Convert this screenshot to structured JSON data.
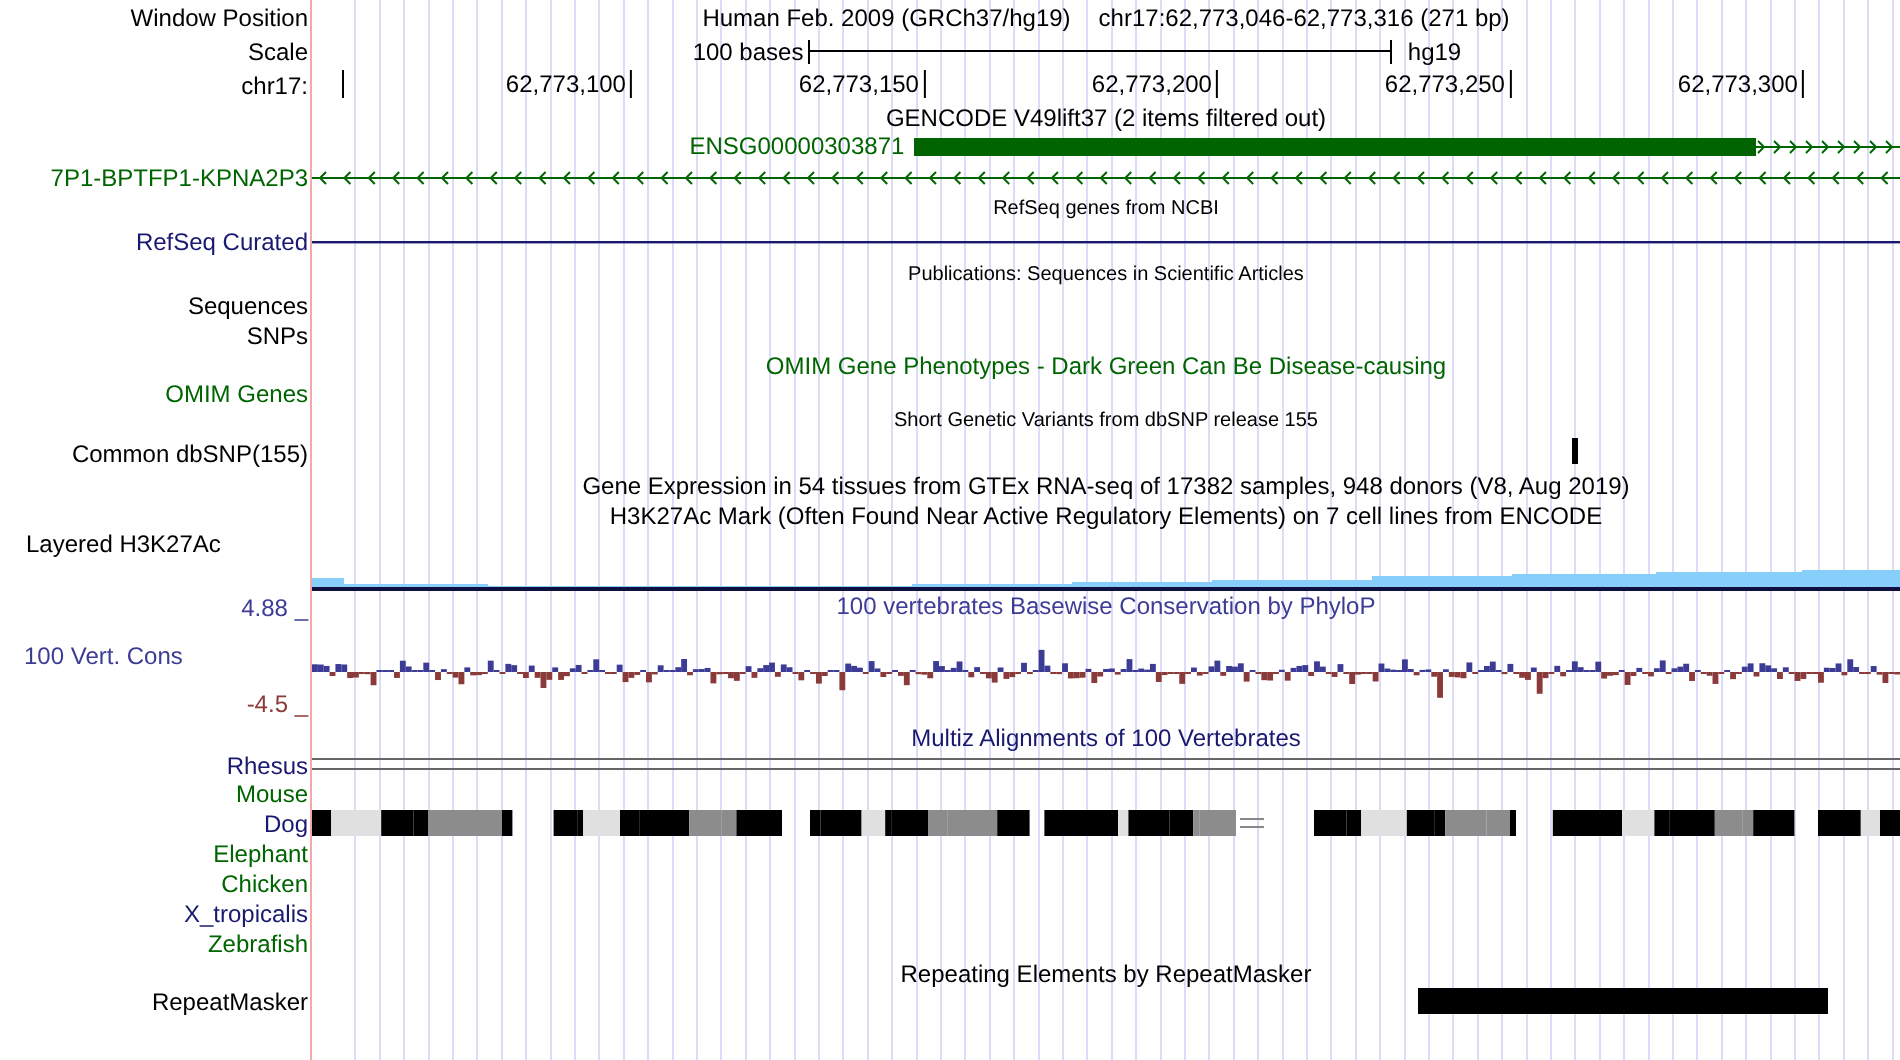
{
  "header": {
    "position_label": "Window Position",
    "assembly": "Human Feb. 2009 (GRCh37/hg19)",
    "position": "chr17:62,773,046-62,773,316 (271 bp)",
    "scale_label": "Scale",
    "scale_text": "100 bases",
    "scale_db": "hg19",
    "chrom_label": "chr17:",
    "ticks": [
      "62,773,100",
      "62,773,150",
      "62,773,200",
      "62,773,250",
      "62,773,300"
    ]
  },
  "tracks": [
    {
      "kind": "title",
      "title": "GENCODE V49lift37 (2 items filtered out)",
      "color": "#000000"
    },
    {
      "kind": "gene",
      "item": "ENSG00000303871",
      "color": "#006400"
    },
    {
      "kind": "genepred",
      "label": "7P1-BPTFP1-KPNA2P3",
      "color": "#006400"
    },
    {
      "kind": "subtitle",
      "title": "RefSeq genes from NCBI",
      "color": "#000000"
    },
    {
      "kind": "line",
      "label": "RefSeq Curated",
      "color": "#191970"
    },
    {
      "kind": "subtitle",
      "title": "Publications: Sequences in Scientific Articles",
      "color": "#000000"
    },
    {
      "kind": "empty",
      "label": "Sequences",
      "color": "#000000"
    },
    {
      "kind": "empty",
      "label": "SNPs",
      "color": "#000000"
    },
    {
      "kind": "title",
      "title": "OMIM Gene Phenotypes - Dark Green Can Be Disease-causing",
      "color": "#006400"
    },
    {
      "kind": "short",
      "label": "OMIM Genes",
      "color": "#006400"
    },
    {
      "kind": "subtitle",
      "title": "Short Genetic Variants from dbSNP release 155",
      "color": "#000000"
    },
    {
      "kind": "snp",
      "label": "Common dbSNP(155)",
      "color": "#000000"
    },
    {
      "kind": "title",
      "title": "Gene Expression in 54 tissues from GTEx RNA-seq of 17382 samples, 948 donors (V8, Aug 2019)",
      "color": "#000000"
    },
    {
      "kind": "title",
      "title": "H3K27Ac Mark (Often Found Near Active Regulatory Elements) on 7 cell lines from ENCODE",
      "color": "#000000"
    },
    {
      "kind": "signal",
      "label": "Layered H3K27Ac",
      "color": "#000000"
    },
    {
      "kind": "cons",
      "title": "100 vertebrates Basewise Conservation by PhyloP",
      "label": "100 Vert. Cons",
      "max": "4.88 _",
      "min": "-4.5 _",
      "color": "#3c3c96"
    },
    {
      "kind": "title",
      "title": "Multiz Alignments of 100 Vertebrates",
      "color": "#191970"
    },
    {
      "kind": "double",
      "label": "Rhesus",
      "color": "#191970"
    },
    {
      "kind": "empty",
      "label": "Mouse",
      "color": "#006400"
    },
    {
      "kind": "align",
      "label": "Dog",
      "color": "#191970"
    },
    {
      "kind": "empty",
      "label": "Elephant",
      "color": "#006400"
    },
    {
      "kind": "empty",
      "label": "Chicken",
      "color": "#006400"
    },
    {
      "kind": "empty",
      "label": "X_tropicalis",
      "color": "#191970"
    },
    {
      "kind": "empty",
      "label": "Zebrafish",
      "color": "#006400"
    },
    {
      "kind": "title",
      "title": "Repeating Elements by RepeatMasker",
      "color": "#000000"
    },
    {
      "kind": "repeat",
      "label": "RepeatMasker",
      "color": "#000000"
    }
  ]
}
